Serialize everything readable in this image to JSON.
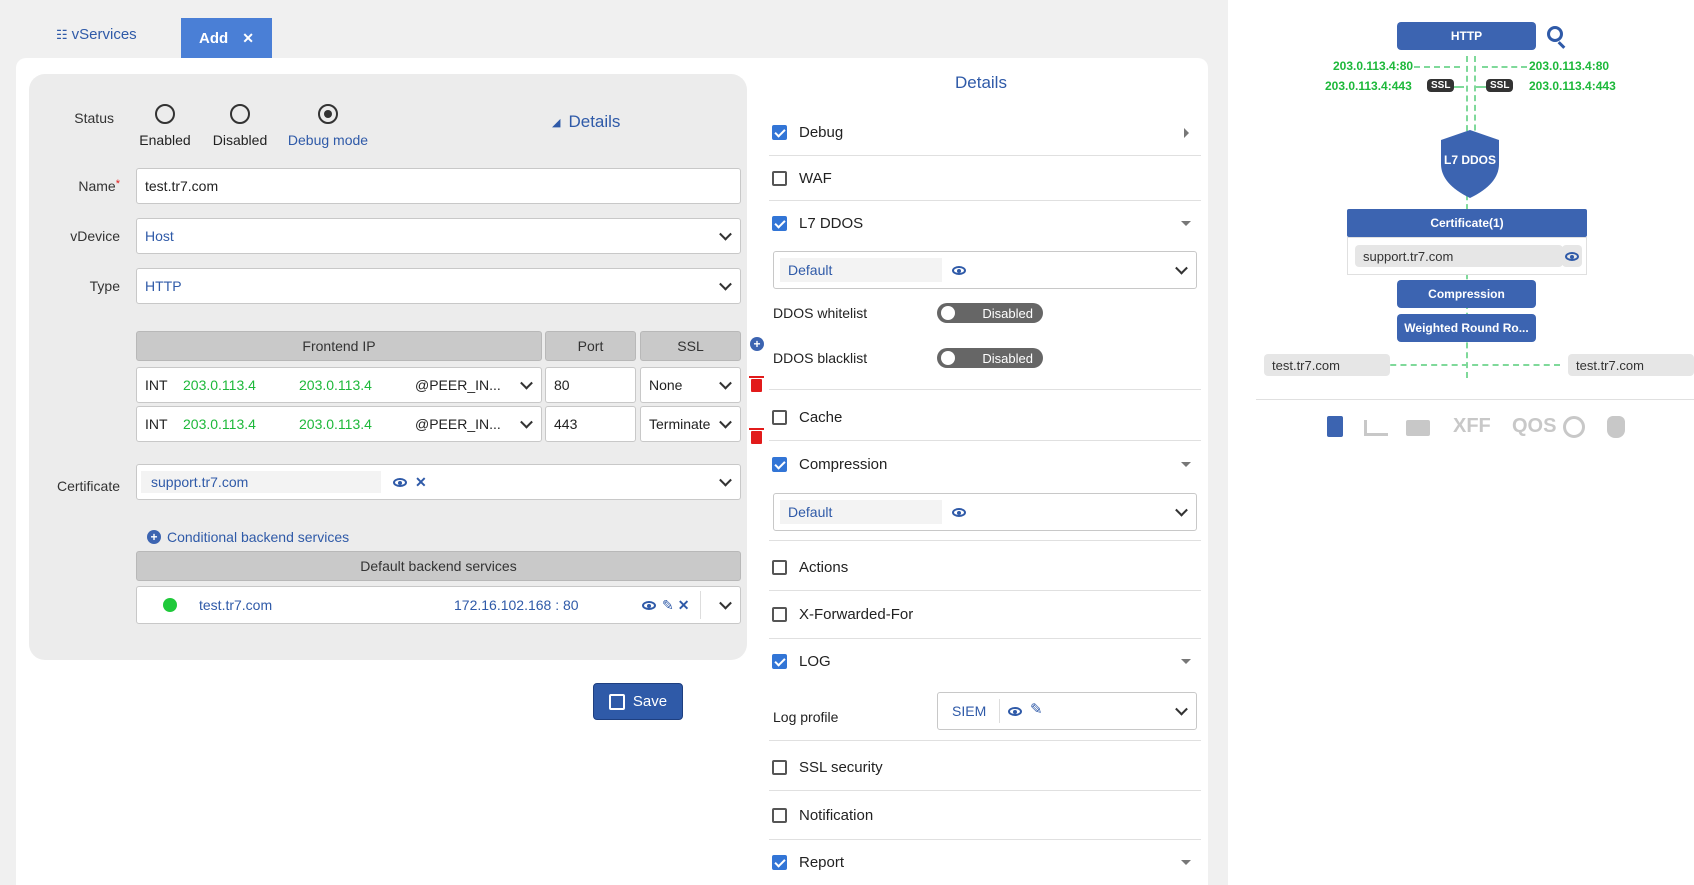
{
  "tabs": {
    "vservices": "vServices",
    "add": "Add"
  },
  "form": {
    "status_label": "Status",
    "status_options": [
      "Enabled",
      "Disabled",
      "Debug mode"
    ],
    "details_link": "Details",
    "name_label": "Name",
    "name_value": "test.tr7.com",
    "vdevice_label": "vDevice",
    "vdevice_value": "Host",
    "type_label": "Type",
    "type_value": "HTTP",
    "table_headers": {
      "frontend_ip": "Frontend IP",
      "port": "Port",
      "ssl": "SSL"
    },
    "frontend_rows": [
      {
        "iface": "INT",
        "ip1": "203.0.113.4",
        "ip2": "203.0.113.4",
        "peer": "@PEER_IN...",
        "port": "80",
        "ssl": "None"
      },
      {
        "iface": "INT",
        "ip1": "203.0.113.4",
        "ip2": "203.0.113.4",
        "peer": "@PEER_IN...",
        "port": "443",
        "ssl": "Terminate"
      }
    ],
    "certificate_label": "Certificate",
    "certificate_value": "support.tr7.com",
    "conditional_link": "Conditional backend services",
    "default_backend_header": "Default backend services",
    "backend": {
      "name": "test.tr7.com",
      "address": "172.16.102.168 : 80"
    },
    "save_label": "Save"
  },
  "details": {
    "title": "Details",
    "items": {
      "debug": "Debug",
      "waf": "WAF",
      "l7ddos": "L7 DDOS",
      "l7ddos_select": "Default",
      "ddos_whitelist": "DDOS whitelist",
      "ddos_blacklist": "DDOS blacklist",
      "toggle_state": "Disabled",
      "cache": "Cache",
      "compression": "Compression",
      "compression_select": "Default",
      "actions": "Actions",
      "xff": "X-Forwarded-For",
      "log": "LOG",
      "log_profile_label": "Log profile",
      "log_profile_value": "SIEM",
      "ssl_security": "SSL security",
      "notification": "Notification",
      "report": "Report"
    }
  },
  "diagram": {
    "http": "HTTP",
    "left_ips": [
      "203.0.113.4:80",
      "203.0.113.4:443"
    ],
    "right_ips": [
      "203.0.113.4:80",
      "203.0.113.4:443"
    ],
    "ssl": "SSL",
    "shield": "L7 DDOS",
    "certificate_header": "Certificate(1)",
    "certificate_item": "support.tr7.com",
    "compression": "Compression",
    "weighted": "Weighted Round Ro...",
    "left_host": "test.tr7.com",
    "right_host": "test.tr7.com",
    "toolbar": [
      "XFF",
      "QOS"
    ]
  },
  "colors": {
    "accent": "#2f5aa8",
    "tab_active": "#4a7fd6",
    "ip_green": "#1db83a",
    "diagram_blue": "#3c64b1"
  }
}
